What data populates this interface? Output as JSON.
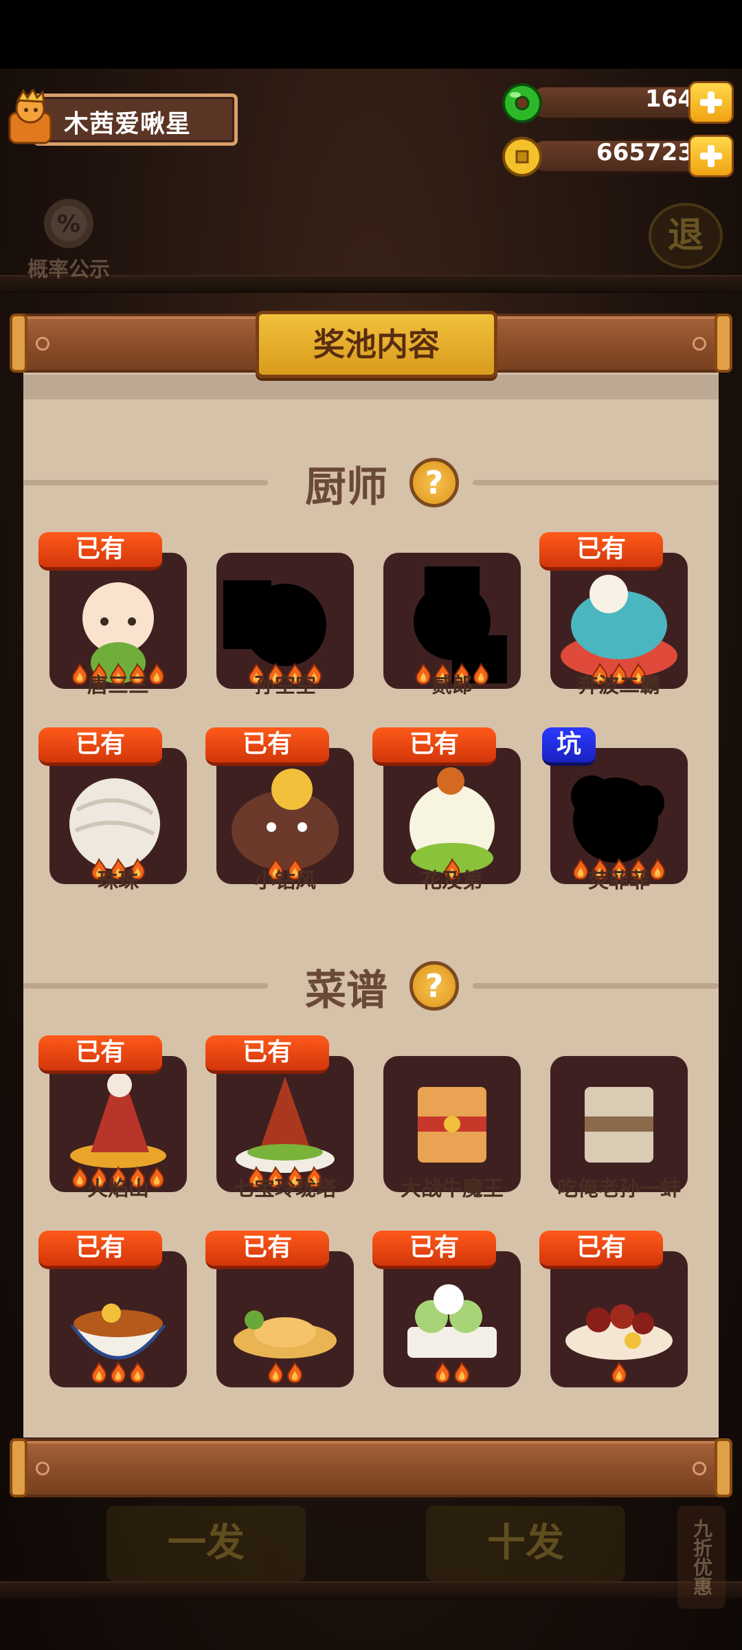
{
  "player": {
    "name": "木茜爱啾星"
  },
  "currencies": {
    "jade": {
      "value": "164",
      "icon": "jade-icon"
    },
    "gold": {
      "value": "665723",
      "icon": "coin-icon"
    }
  },
  "top_left_button": {
    "symbol": "%",
    "label": "概率公示"
  },
  "exit_button": {
    "label": "退"
  },
  "panel": {
    "title": "奖池内容",
    "sections": {
      "chefs": {
        "title": "厨师",
        "help": "?"
      },
      "recipes": {
        "title": "菜谱",
        "help": "?"
      }
    }
  },
  "chefs": [
    {
      "name": "唐三三",
      "badge": "已有",
      "rarity": 5
    },
    {
      "name": "孙空空",
      "badge": "",
      "rarity": 4
    },
    {
      "name": "贰郎",
      "badge": "",
      "rarity": 4
    },
    {
      "name": "奔波二霸",
      "badge": "已有",
      "rarity": 3
    },
    {
      "name": "珠珠",
      "badge": "已有",
      "rarity": 3
    },
    {
      "name": "小钻风",
      "badge": "已有",
      "rarity": 2
    },
    {
      "name": "花及第",
      "badge": "已有",
      "rarity": 1
    },
    {
      "name": "荧菲菲",
      "badge": "坑",
      "rarity": 5
    }
  ],
  "recipes": [
    {
      "name": "火焰山",
      "badge": "已有",
      "rarity": 5
    },
    {
      "name": "七宝玲珑塔",
      "badge": "已有",
      "rarity": 4
    },
    {
      "name": "大战牛魔王",
      "badge": "",
      "rarity": 0
    },
    {
      "name": "吃俺老孙一蚌",
      "badge": "",
      "rarity": 0
    },
    {
      "name": "",
      "badge": "已有",
      "rarity": 3
    },
    {
      "name": "",
      "badge": "已有",
      "rarity": 2
    },
    {
      "name": "",
      "badge": "已有",
      "rarity": 2
    },
    {
      "name": "",
      "badge": "已有",
      "rarity": 1
    }
  ],
  "bottom": {
    "single": "一发",
    "ten": "十发",
    "discount": "九折优惠"
  },
  "colors": {
    "owned_badge": "#e5420f",
    "pit_badge": "#2230e0",
    "card_bg": "#3f2020",
    "panel_bg": "#d6c1a9",
    "title_plaque": "#e9b22e"
  }
}
